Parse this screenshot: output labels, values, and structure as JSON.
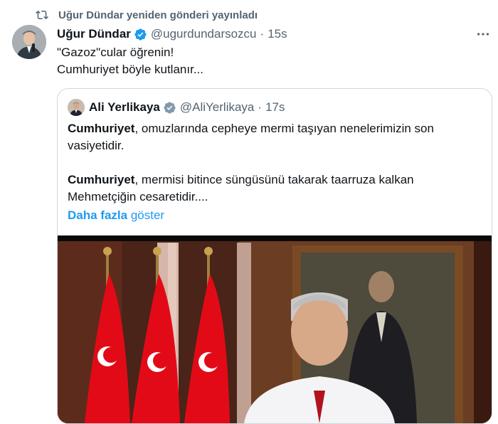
{
  "repost": {
    "text": "Uğur Dündar yeniden gönderi yayınladı",
    "icon": "repost-icon"
  },
  "tweet": {
    "name": "Uğur Dündar",
    "handle": "@ugurdundarsozcu",
    "separator": "·",
    "time": "15s",
    "lines": [
      "\"Gazoz\"cular öğrenin!",
      "Cumhuriyet böyle kutlanır..."
    ]
  },
  "quote": {
    "name": "Ali Yerlikaya",
    "handle": "@AliYerlikaya",
    "separator": "·",
    "time": "17s",
    "p1_bold": "Cumhuriyet",
    "p1_rest": ", omuzlarında cepheye mermi taşıyan nenelerimizin son vasiyetidir.",
    "p2_bold": "Cumhuriyet",
    "p2_rest": ", mermisi bitince süngüsünü takarak taarruza kalkan Mehmetçiğin cesaretidir....",
    "show_more_1": "Daha fazla",
    "show_more_2": "göster"
  },
  "colors": {
    "accent": "#1d9bf0",
    "secondary_text": "#536471",
    "border": "#cfd9de",
    "flag_red": "#e30a17"
  }
}
